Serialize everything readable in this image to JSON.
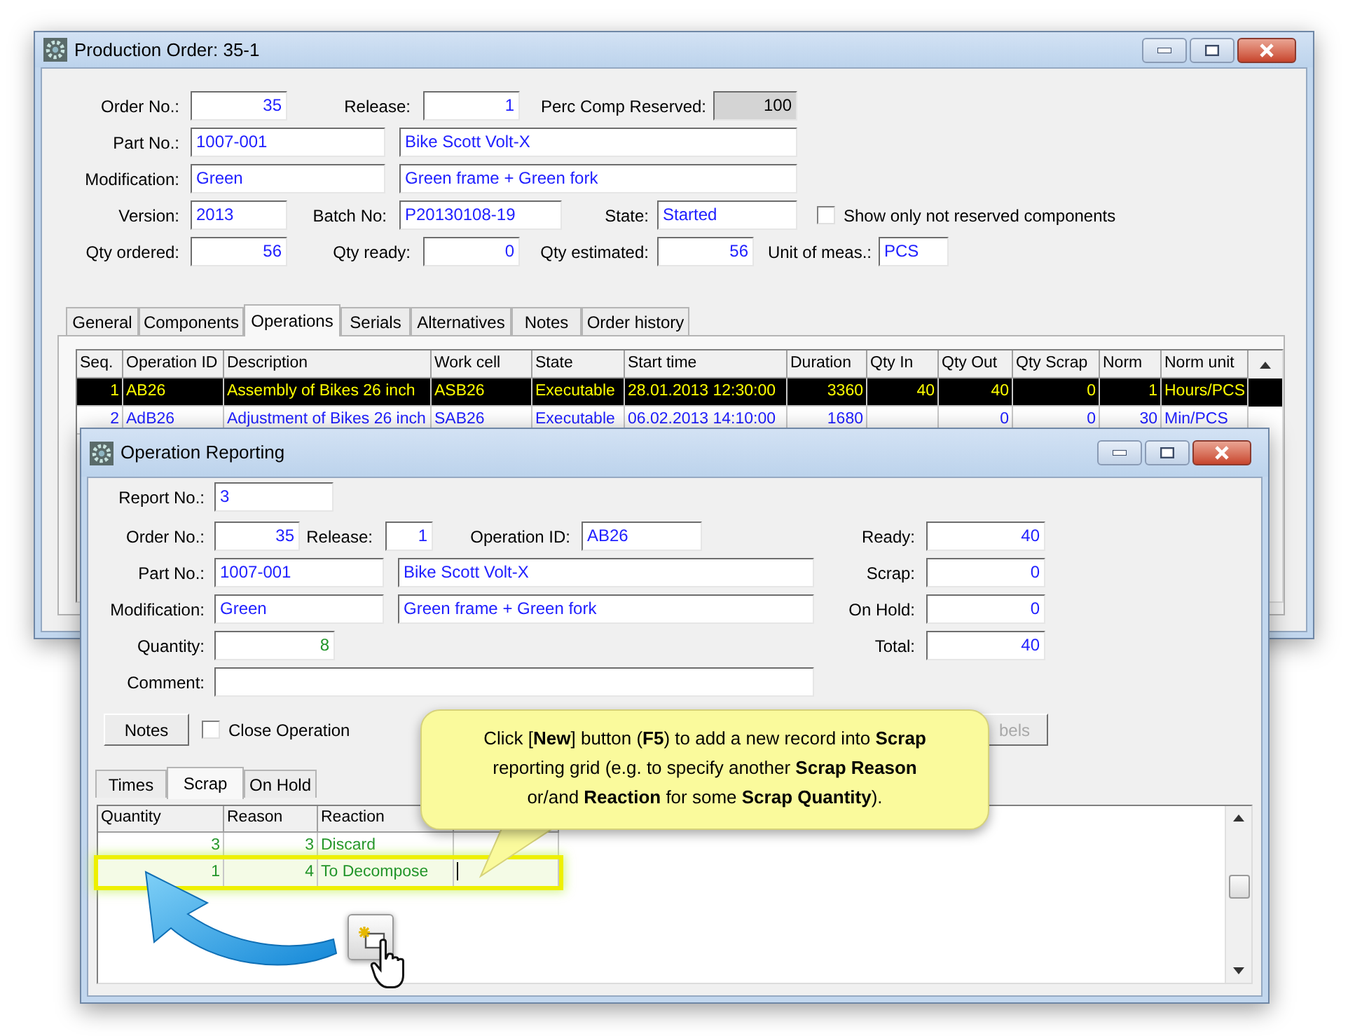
{
  "production_order": {
    "title": "Production Order: 35-1",
    "order_no": {
      "label": "Order No.:",
      "value": "35"
    },
    "release": {
      "label": "Release:",
      "value": "1"
    },
    "perc_comp_reserved": {
      "label": "Perc Comp Reserved:",
      "value": "100"
    },
    "part_no": {
      "label": "Part No.:",
      "value": "1007-001",
      "description": "Bike Scott Volt-X"
    },
    "modification": {
      "label": "Modification:",
      "value": "Green",
      "description": "Green frame + Green fork"
    },
    "version": {
      "label": "Version:",
      "value": "2013"
    },
    "batch_no": {
      "label": "Batch No:",
      "value": "P20130108-19"
    },
    "state": {
      "label": "State:",
      "value": "Started"
    },
    "show_only_not_reserved": {
      "label": "Show only not reserved components",
      "checked": false
    },
    "qty_ordered": {
      "label": "Qty ordered:",
      "value": "56"
    },
    "qty_ready": {
      "label": "Qty ready:",
      "value": "0"
    },
    "qty_estimated": {
      "label": "Qty estimated:",
      "value": "56"
    },
    "unit_of_meas": {
      "label": "Unit of meas.:",
      "value": "PCS"
    },
    "tabs": [
      {
        "label": "General",
        "selected": false
      },
      {
        "label": "Components",
        "selected": false
      },
      {
        "label": "Operations",
        "selected": true
      },
      {
        "label": "Serials",
        "selected": false
      },
      {
        "label": "Alternatives",
        "selected": false
      },
      {
        "label": "Notes",
        "selected": false
      },
      {
        "label": "Order history",
        "selected": false
      }
    ],
    "operations_grid": {
      "columns": [
        "Seq.",
        "Operation ID",
        "Description",
        "Work cell",
        "State",
        "Start time",
        "Duration",
        "Qty In",
        "Qty Out",
        "Qty Scrap",
        "Norm",
        "Norm unit"
      ],
      "rows": [
        {
          "cells": [
            "1",
            "AB26",
            "Assembly of Bikes 26 inch",
            "ASB26",
            "Executable",
            "28.01.2013 12:30:00",
            "3360",
            "40",
            "40",
            "0",
            "1",
            "Hours/PCS"
          ],
          "selected": true
        },
        {
          "cells": [
            "2",
            "AdB26",
            "Adjustment of Bikes 26 inch",
            "SAB26",
            "Executable",
            "06.02.2013 14:10:00",
            "1680",
            "",
            "0",
            "0",
            "30",
            "Min/PCS"
          ],
          "selected": false
        }
      ]
    }
  },
  "operation_reporting": {
    "title": "Operation Reporting",
    "report_no": {
      "label": "Report No.:",
      "value": "3"
    },
    "order_no": {
      "label": "Order No.:",
      "value": "35"
    },
    "release": {
      "label": "Release:",
      "value": "1"
    },
    "operation_id": {
      "label": "Operation ID:",
      "value": "AB26"
    },
    "part_no": {
      "label": "Part No.:",
      "value": "1007-001",
      "description": "Bike Scott Volt-X"
    },
    "modification": {
      "label": "Modification:",
      "value": "Green",
      "description": "Green frame + Green fork"
    },
    "quantity": {
      "label": "Quantity:",
      "value": "8"
    },
    "comment": {
      "label": "Comment:"
    },
    "ready": {
      "label": "Ready:",
      "value": "40"
    },
    "scrap": {
      "label": "Scrap:",
      "value": "0"
    },
    "on_hold": {
      "label": "On Hold:",
      "value": "0"
    },
    "total": {
      "label": "Total:",
      "value": "40"
    },
    "notes_button": "Notes",
    "close_operation": {
      "label": "Close Operation",
      "checked": false
    },
    "labels_button": {
      "label": "bels",
      "disabled": true
    },
    "tabs": [
      {
        "label": "Times",
        "selected": false
      },
      {
        "label": "Scrap",
        "selected": true
      },
      {
        "label": "On Hold",
        "selected": false
      }
    ],
    "scrap_grid": {
      "columns": [
        "Quantity",
        "Reason",
        "Reaction"
      ],
      "rows": [
        {
          "cells": [
            "3",
            "3",
            "Discard"
          ],
          "selected": false
        },
        {
          "cells": [
            "1",
            "4",
            "To Decompose"
          ],
          "selected": true
        }
      ]
    }
  },
  "callout": {
    "text": "Click [**New**] button (**F5**) to add a new record into **Scrap** reporting grid (e.g. to specify another **Scrap Reason** or/and **Reaction** for some **Scrap Quantity**)."
  }
}
